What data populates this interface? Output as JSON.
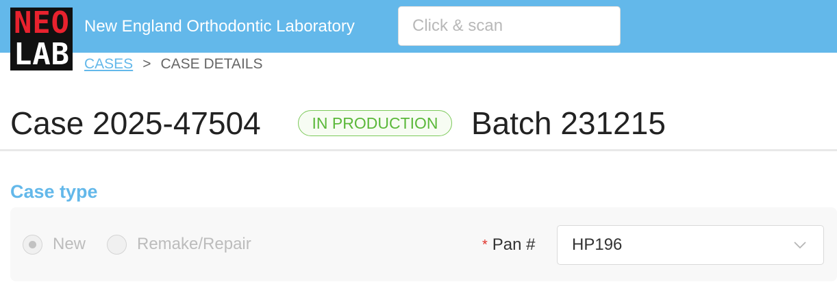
{
  "header": {
    "logo_letters_top": [
      "N",
      "E",
      "O"
    ],
    "logo_letters_bottom": [
      "L",
      "A",
      "B"
    ],
    "app_title": "New England Orthodontic Laboratory",
    "search_placeholder": "Click & scan"
  },
  "breadcrumb": {
    "link": "CASES",
    "separator": ">",
    "current": "CASE DETAILS"
  },
  "case": {
    "title": "Case 2025-47504",
    "status": "IN PRODUCTION",
    "batch": "Batch 231215"
  },
  "case_type": {
    "section_title": "Case type",
    "options": [
      {
        "label": "New",
        "selected": true
      },
      {
        "label": "Remake/Repair",
        "selected": false
      }
    ],
    "pan": {
      "required_mark": "*",
      "label": "Pan #",
      "value": "HP196"
    }
  },
  "colors": {
    "topbar": "#63b8ea",
    "accent": "#63b8ea",
    "status_green": "#5bb83a",
    "logo_red": "#e8222e"
  }
}
